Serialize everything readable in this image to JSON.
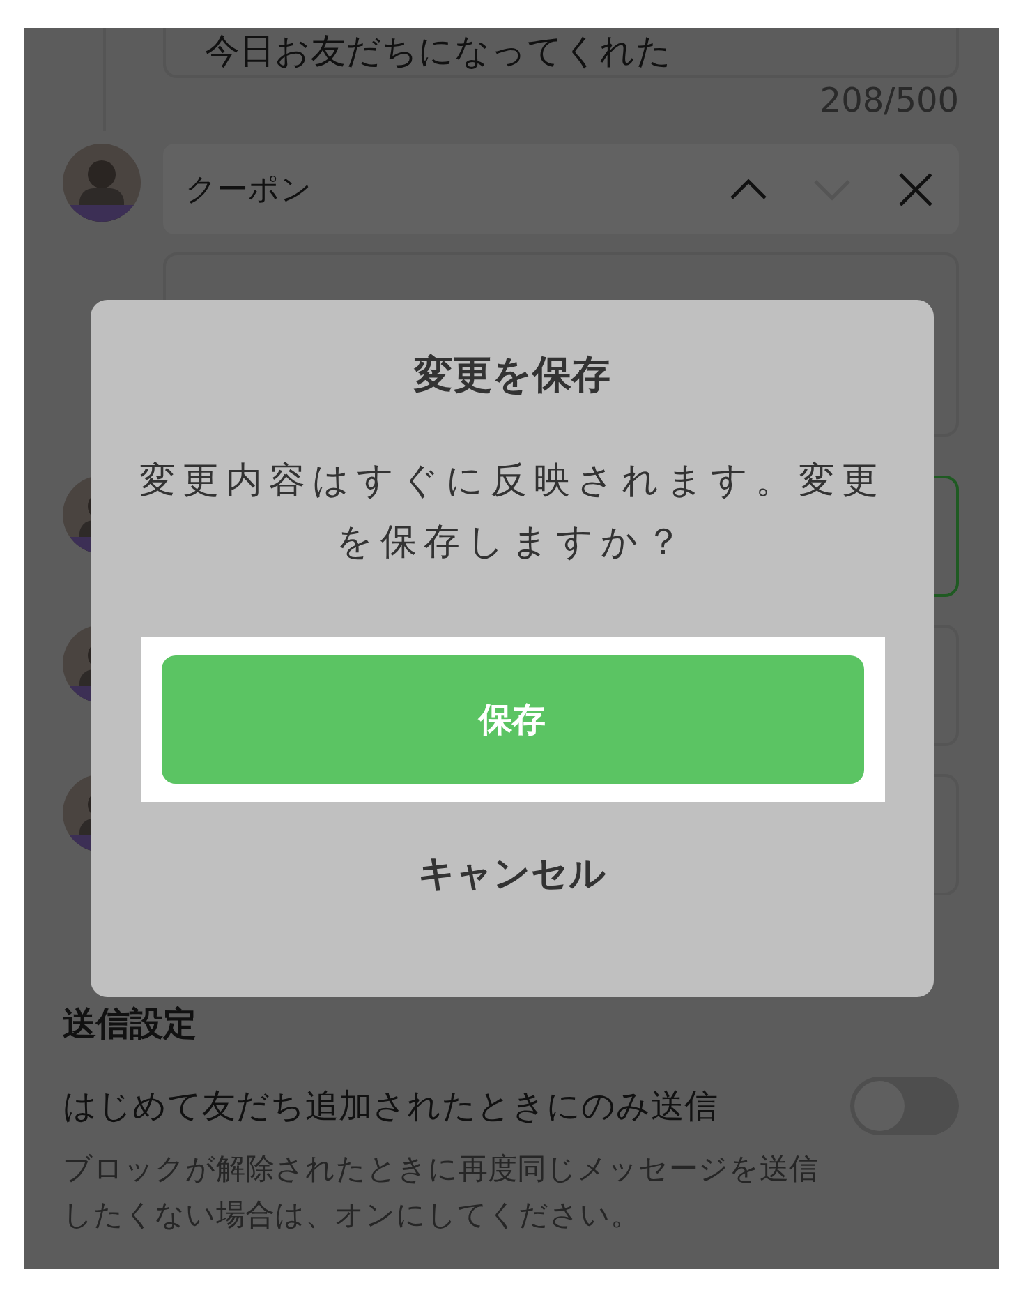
{
  "message_preview": {
    "text": "今日お友だちになってくれた",
    "count": "208/500"
  },
  "coupon_block": {
    "label": "クーポン",
    "move_up_disabled": false,
    "move_down_disabled": true
  },
  "message_boxes": [
    {
      "focused": true
    },
    {
      "focused": false
    },
    {
      "focused": false
    }
  ],
  "dialog": {
    "title": "変更を保存",
    "message": "変更内容はすぐに反映されます。変更を保存しますか？",
    "buttons": [
      {
        "label": "保存",
        "kind": "primary",
        "highlighted": true
      },
      {
        "label": "キャンセル",
        "kind": "text",
        "highlighted": false
      }
    ]
  },
  "send_settings": {
    "heading": "送信設定",
    "option": {
      "label": "はじめて友だち追加されたときにのみ送信",
      "on": false
    },
    "hint": "ブロックが解除されたときに再度同じメッセージを送信したくない場合は、オンにしてください。"
  }
}
